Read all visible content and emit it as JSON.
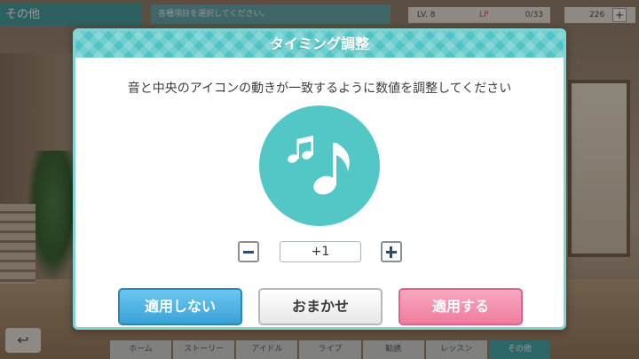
{
  "hud": {
    "section_title": "その他",
    "info_text": "各種項目を選択してください。",
    "lv_label": "LV.",
    "lv_value": "8",
    "lp_label": "LP",
    "lp_value": "0/33",
    "gems": "226",
    "plus": "+"
  },
  "dialog": {
    "title": "タイミング調整",
    "instruction": "音と中央のアイコンの動きが一致するように数値を調整してください",
    "icon": "music-notes-icon",
    "stepper": {
      "value": "+1"
    },
    "buttons": {
      "not_apply": "適用しない",
      "auto": "おまかせ",
      "apply": "適用する"
    }
  },
  "nav": {
    "back": "↩",
    "items": [
      "ホーム",
      "ストーリー",
      "アイドル",
      "ライブ",
      "勧誘",
      "レッスン",
      "その他"
    ],
    "active_index": 6
  },
  "colors": {
    "accent": "#52c3c3",
    "icon_circle": "#53c7c6",
    "btn_blue": "#3aa2d8",
    "btn_pink": "#ef7c9e"
  }
}
